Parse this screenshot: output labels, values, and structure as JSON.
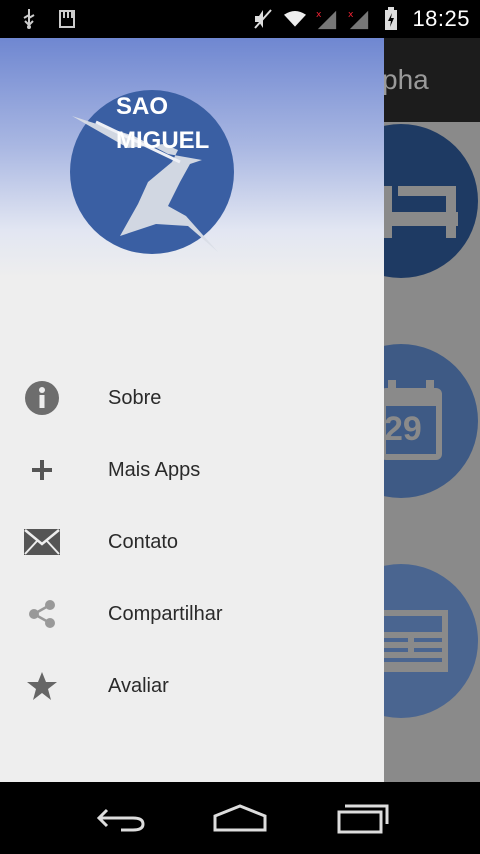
{
  "status_bar": {
    "time": "18:25",
    "icons": [
      "usb-icon",
      "sd-card-icon",
      "mute-icon",
      "wifi-icon",
      "signal-icon",
      "signal-icon",
      "battery-charging-icon"
    ]
  },
  "background_app": {
    "title_fragment": "pha",
    "tiles": [
      {
        "icon": "bed-icon"
      },
      {
        "icon": "calendar-icon",
        "date": "29"
      },
      {
        "icon": "newspaper-icon"
      }
    ]
  },
  "drawer": {
    "logo": {
      "line1": "SAO",
      "line2": "MIGUEL"
    },
    "items": [
      {
        "label": "Sobre",
        "icon": "info-icon"
      },
      {
        "label": "Mais Apps",
        "icon": "plus-icon"
      },
      {
        "label": "Contato",
        "icon": "mail-icon"
      },
      {
        "label": "Compartilhar",
        "icon": "share-icon"
      },
      {
        "label": "Avaliar",
        "icon": "star-icon"
      }
    ]
  },
  "nav_bar": {
    "buttons": [
      "back-icon",
      "home-icon",
      "recents-icon"
    ]
  },
  "colors": {
    "logo_blue": "#3a5fa3",
    "drawer_bg": "#eeeeee",
    "tile_blue": "#1e3a63"
  }
}
